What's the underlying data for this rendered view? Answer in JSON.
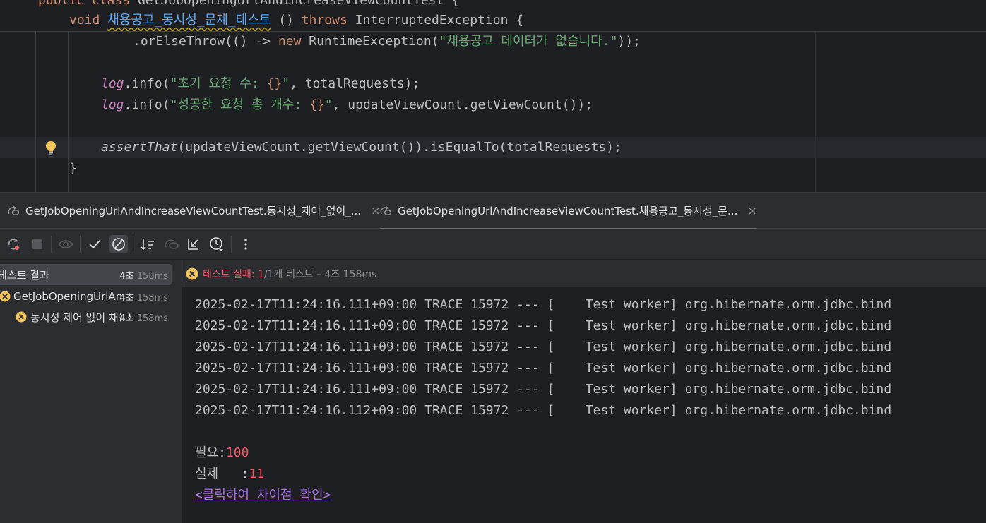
{
  "editor": {
    "line0": {
      "kw": "public class",
      "rest": " GetJobOpeningUrlAndIncreaseViewCountTest {"
    },
    "line1": {
      "kw_void": "void",
      "method": "채용공고_동시성_문제_테스트",
      "parens": " () ",
      "kw_throws": "throws",
      "rest": " InterruptedException {"
    },
    "line2": {
      "pre": ".orElseThrow(() -> ",
      "kw_new": "new",
      "mid": " RuntimeException(",
      "str": "\"채용공고 데이터가 없습니다.\"",
      "end": "));"
    },
    "line3": {
      "field": "log",
      "call": ".info(",
      "str_a": "\"초기 요청 수: ",
      "ph": "{}",
      "str_b": "\"",
      "end": ", totalRequests);"
    },
    "line4": {
      "field": "log",
      "call": ".info(",
      "str_a": "\"성공한 요청 총 개수: ",
      "ph": "{}",
      "str_b": "\"",
      "end": ", updateViewCount.getViewCount());"
    },
    "line5": {
      "ital": "assertThat",
      "rest": "(updateViewCount.getViewCount()).isEqualTo(totalRequests);"
    },
    "line6": "}"
  },
  "tabs": [
    {
      "label": "GetJobOpeningUrlAndIncreaseViewCountTest.동시성_제어_없이_...",
      "close": "×"
    },
    {
      "label": "GetJobOpeningUrlAndIncreaseViewCountTest.채용공고_동시성_문...",
      "close": "×"
    }
  ],
  "toolbar": {
    "icons": [
      "rerun-icon",
      "stop-icon",
      "eye-icon",
      "check-icon",
      "ignored-icon",
      "sort-icon",
      "import-icon",
      "export-icon",
      "history-icon",
      "more-icon"
    ]
  },
  "tree": {
    "root": {
      "label": "테스트 결과",
      "dur_a": "4초",
      "dur_b": " 158ms"
    },
    "class": {
      "label": "GetJobOpeningUrlAndIncreaseViewCountTest",
      "dur_a": "4초",
      "dur_b": " 158ms"
    },
    "method": {
      "label": "동시성 제어 없이 채용공고 조회수 증가 테스트",
      "dur_a": "4초",
      "dur_b": " 158ms"
    }
  },
  "status": {
    "failed": "테스트 실패: 1",
    "rest": " /1개 테스트 – 4초 158ms"
  },
  "console": {
    "logs": [
      "2025-02-17T11:24:16.111+09:00 TRACE 15972 --- [    Test worker] org.hibernate.orm.jdbc.bind",
      "2025-02-17T11:24:16.111+09:00 TRACE 15972 --- [    Test worker] org.hibernate.orm.jdbc.bind",
      "2025-02-17T11:24:16.111+09:00 TRACE 15972 --- [    Test worker] org.hibernate.orm.jdbc.bind",
      "2025-02-17T11:24:16.111+09:00 TRACE 15972 --- [    Test worker] org.hibernate.orm.jdbc.bind",
      "2025-02-17T11:24:16.111+09:00 TRACE 15972 --- [    Test worker] org.hibernate.orm.jdbc.bind",
      "2025-02-17T11:24:16.112+09:00 TRACE 15972 --- [    Test worker] org.hibernate.orm.jdbc.bind"
    ],
    "expected_label": "필요:",
    "expected_value": "100",
    "actual_label": "실제   :",
    "actual_value": "11",
    "diff_link": "<클릭하여 차이점 확인>"
  },
  "colors": {
    "background": "#1e1f22",
    "panel": "#2b2d30",
    "keyword": "#cf8e6d",
    "string": "#6aab73",
    "field": "#c77dbb",
    "error": "#f75464",
    "link": "#a571e6"
  }
}
